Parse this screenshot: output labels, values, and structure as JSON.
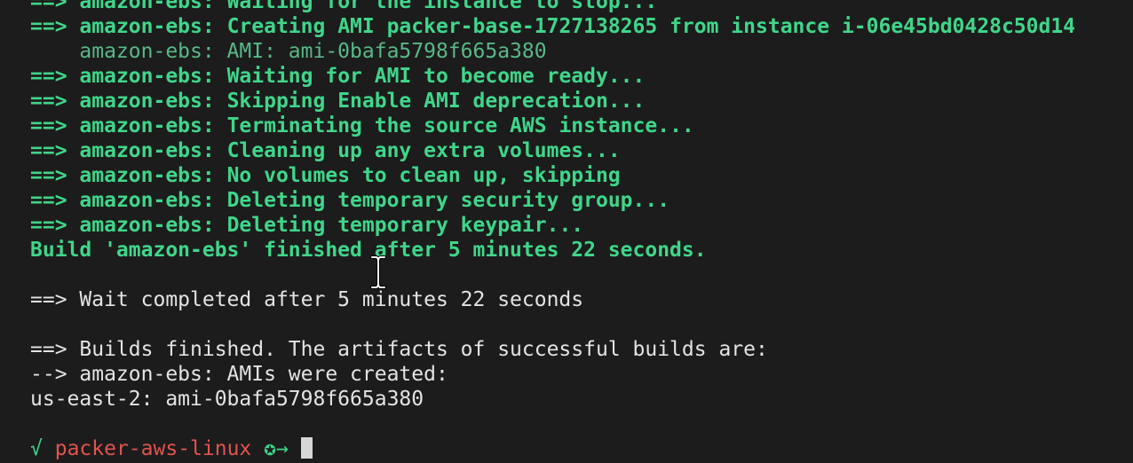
{
  "terminal": {
    "lines": [
      {
        "arrow": "==>",
        "text": "amazon-ebs: Waiting for the instance to stop..."
      },
      {
        "arrow": "==>",
        "text": "amazon-ebs: Creating AMI packer-base-1727138265 from instance i-06e45bd0428c50d14"
      },
      {
        "indent": "    ",
        "text": "amazon-ebs: AMI: ami-0bafa5798f665a380"
      },
      {
        "arrow": "==>",
        "text": "amazon-ebs: Waiting for AMI to become ready..."
      },
      {
        "arrow": "==>",
        "text": "amazon-ebs: Skipping Enable AMI deprecation..."
      },
      {
        "arrow": "==>",
        "text": "amazon-ebs: Terminating the source AWS instance..."
      },
      {
        "arrow": "==>",
        "text": "amazon-ebs: Cleaning up any extra volumes..."
      },
      {
        "arrow": "==>",
        "text": "amazon-ebs: No volumes to clean up, skipping"
      },
      {
        "arrow": "==>",
        "text": "amazon-ebs: Deleting temporary security group..."
      },
      {
        "arrow": "==>",
        "text": "amazon-ebs: Deleting temporary keypair..."
      },
      {
        "text": "Build 'amazon-ebs' finished after 5 minutes 22 seconds."
      },
      {
        "text": ""
      },
      {
        "text": "==> Wait completed after 5 minutes 22 seconds"
      },
      {
        "text": ""
      },
      {
        "text": "==> Builds finished. The artifacts of successful builds are:"
      },
      {
        "text": "--> amazon-ebs: AMIs were created:"
      },
      {
        "text": "us-east-2: ami-0bafa5798f665a380"
      },
      {
        "text": ""
      }
    ],
    "prompt": {
      "check": "√",
      "directory": "packer-aws-linux",
      "symbol": "✪→"
    }
  },
  "colors": {
    "background": "#1c1c1c",
    "green": "#3fd68a",
    "dim_green": "#58b887",
    "white": "#e3e3e3",
    "red": "#e2534f"
  },
  "icons": {
    "cursor": "text-ibeam-cursor"
  }
}
